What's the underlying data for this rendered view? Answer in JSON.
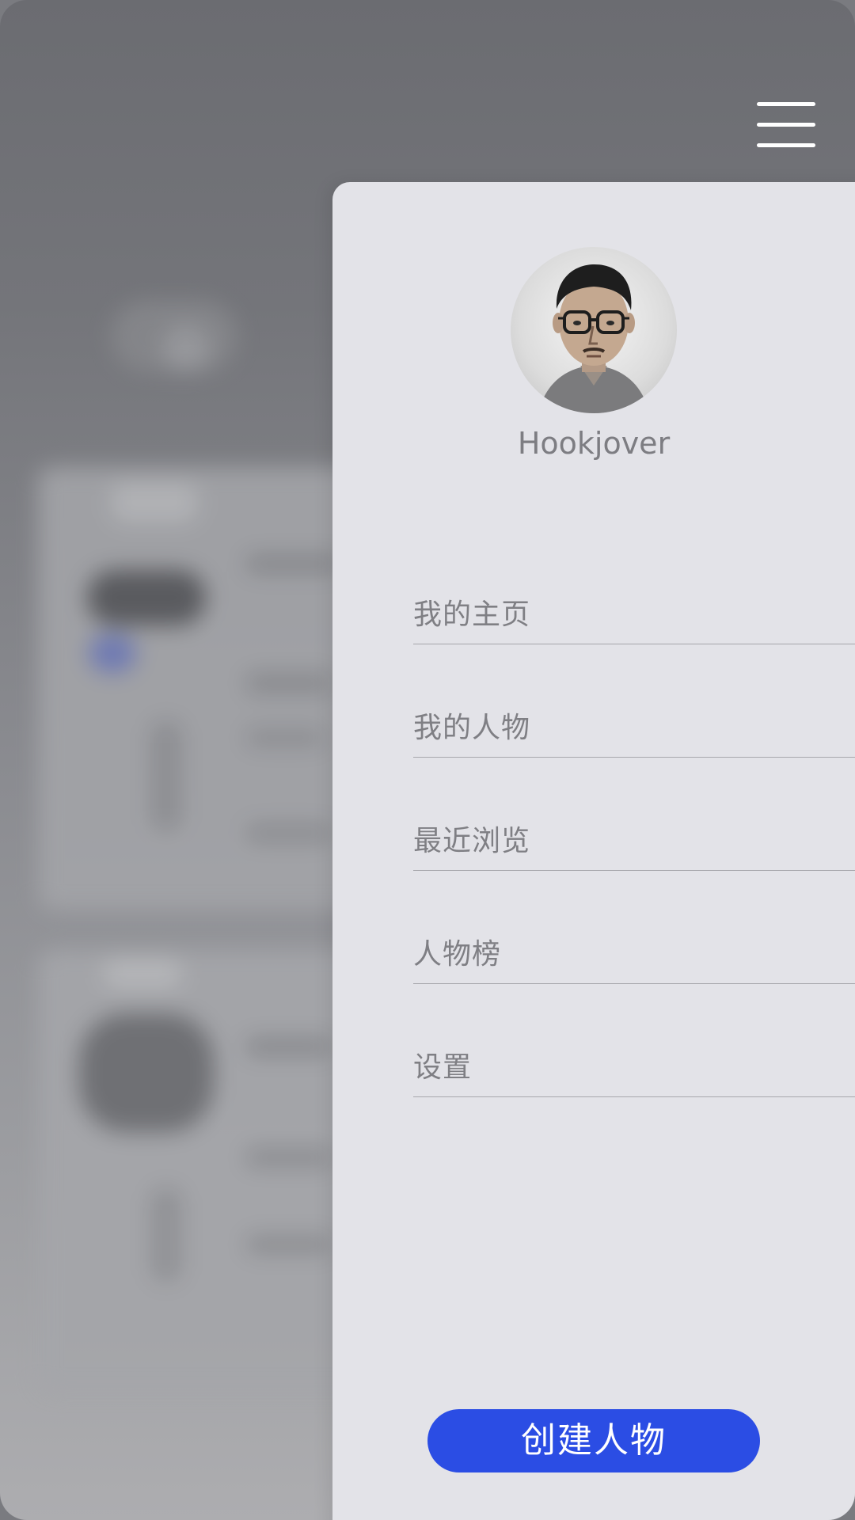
{
  "drawer": {
    "username": "Hookjover",
    "menu_items": [
      {
        "label": "我的主页"
      },
      {
        "label": "我的人物"
      },
      {
        "label": "最近浏览"
      },
      {
        "label": "人物榜"
      },
      {
        "label": "设置"
      }
    ],
    "create_button_label": "创建人物"
  },
  "icons": {
    "menu": "hamburger-menu-icon",
    "avatar": "user-avatar"
  },
  "colors": {
    "accent": "#2b4de4",
    "drawer_bg": "#e3e3e8",
    "overlay": "#6b6c71"
  }
}
